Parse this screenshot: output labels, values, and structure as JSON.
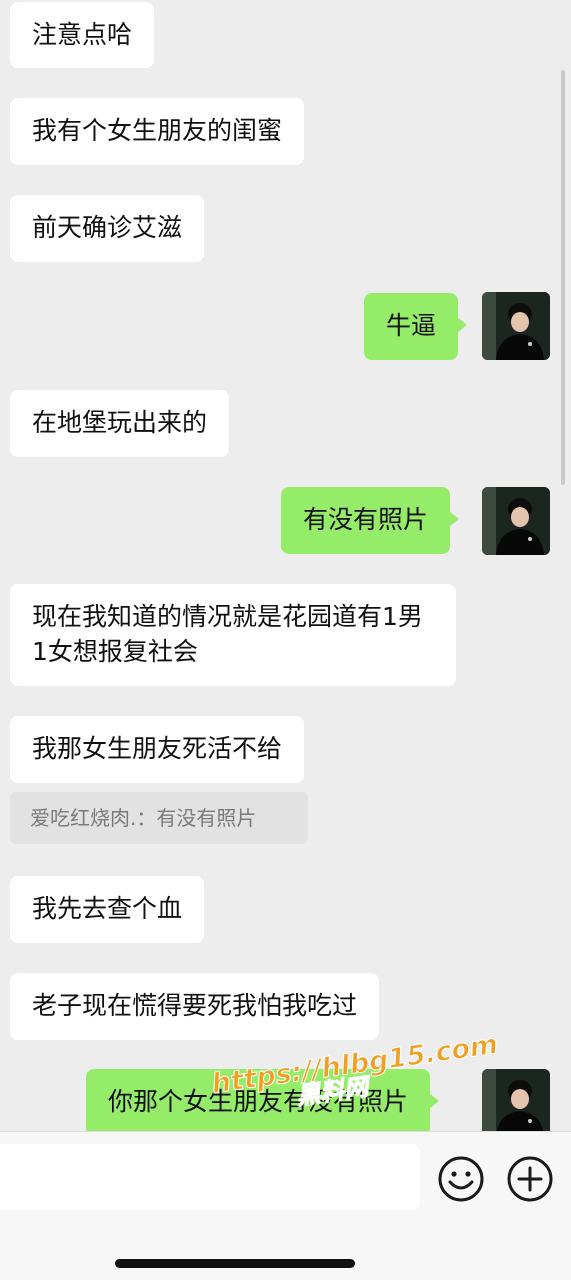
{
  "messages": [
    {
      "side": "received",
      "text": "注意点哈"
    },
    {
      "side": "received",
      "text": "我有个女生朋友的闺蜜"
    },
    {
      "side": "received",
      "text": "前天确诊艾滋"
    },
    {
      "side": "sent",
      "text": "牛逼"
    },
    {
      "side": "received",
      "text": "在地堡玩出来的"
    },
    {
      "side": "sent",
      "text": "有没有照片"
    },
    {
      "side": "received",
      "text": "现在我知道的情况就是花园道有1男1女想报复社会"
    },
    {
      "side": "received",
      "text": "我那女生朋友死活不给"
    },
    {
      "side": "received",
      "text": "我先去查个血"
    },
    {
      "side": "received",
      "text": "老子现在慌得要死我怕我吃过"
    },
    {
      "side": "sent",
      "text": "你那个女生朋友有没有照片"
    }
  ],
  "quote": {
    "text": "爱吃红烧肉.：有没有照片"
  },
  "watermark": {
    "url_text": "https://hlbg15.com",
    "brand_text": "黑料网",
    "color": "#f0a020"
  },
  "input_bar": {
    "emoji_icon": "emoji-icon",
    "add_icon": "plus-icon"
  },
  "colors": {
    "sent_bubble": "#95ec69",
    "received_bubble": "#ffffff",
    "background": "#ededed"
  }
}
